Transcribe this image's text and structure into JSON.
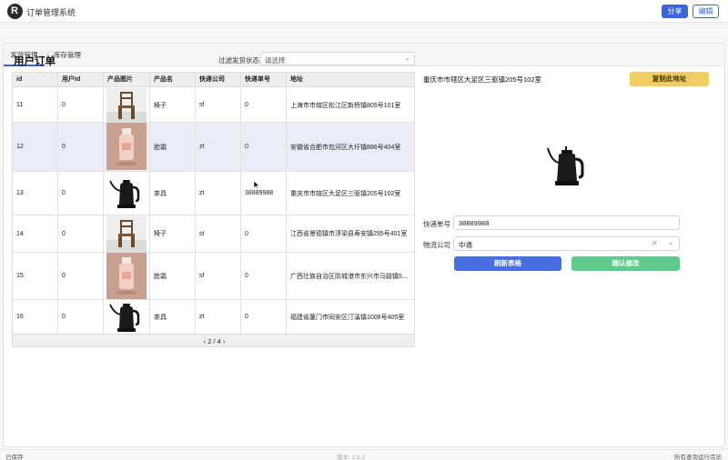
{
  "app": {
    "logo_letter": "R",
    "title": "订单管理系统"
  },
  "header": {
    "share_label": "分享",
    "edit_label": "编辑"
  },
  "tabs": [
    {
      "label": "发货管理",
      "active": true
    },
    {
      "label": "库存管理",
      "active": false
    }
  ],
  "orders": {
    "title": "用户订单",
    "filter": {
      "label": "过滤发货状态",
      "placeholder": "请选择"
    },
    "columns": [
      "id",
      "用户Id",
      "产品图片",
      "产品名",
      "快递公司",
      "快递单号",
      "地址"
    ],
    "rows": [
      {
        "id": "11",
        "user_id": "0",
        "image": "chair",
        "product": "椅子",
        "company": "sf",
        "tracking": "0",
        "address": "上海市市辖区松江区新桥镇805号101室"
      },
      {
        "id": "12",
        "user_id": "0",
        "image": "bottle",
        "product": "脸霜",
        "company": "zt",
        "tracking": "0",
        "address": "安徽省合肥市包河区大圩镇886号404室",
        "selected": true
      },
      {
        "id": "13",
        "user_id": "0",
        "image": "kettle",
        "product": "茶具",
        "company": "zt",
        "tracking": "38889988",
        "address": "重庆市市辖区大足区三驱镇205号102室"
      },
      {
        "id": "14",
        "user_id": "0",
        "image": "chair",
        "product": "椅子",
        "company": "st",
        "tracking": "0",
        "address": "江西省景德镇市浮梁县寿安镇295号401室"
      },
      {
        "id": "15",
        "user_id": "0",
        "image": "bottle",
        "product": "脸霜",
        "company": "sf",
        "tracking": "0",
        "address": "广西壮族自治区防城港市东兴市马路镇5…"
      },
      {
        "id": "16",
        "user_id": "0",
        "image": "kettle",
        "product": "茶具",
        "company": "zt",
        "tracking": "0",
        "address": "福建省厦门市同安区汀溪镇1008号405室"
      }
    ],
    "pager": "‹ 2 / 4 ›"
  },
  "detail": {
    "address": "重庆市市辖区大足区三驱镇205号102室",
    "copy_label": "复制此地址",
    "tracking_label": "快递单号",
    "tracking_value": "38889988",
    "carrier_label": "物流公司",
    "carrier_value": "中通",
    "refresh_label": "刷新表格",
    "confirm_label": "确认修改"
  },
  "footer": {
    "left": "已保存",
    "version": "版本: 1.5.2",
    "right": "所有查询运行完毕"
  },
  "colors": {
    "primary": "#3b66d6",
    "copy_button": "#f0cc62",
    "confirm_button": "#61c98e",
    "selected_row": "#eaecf8"
  }
}
